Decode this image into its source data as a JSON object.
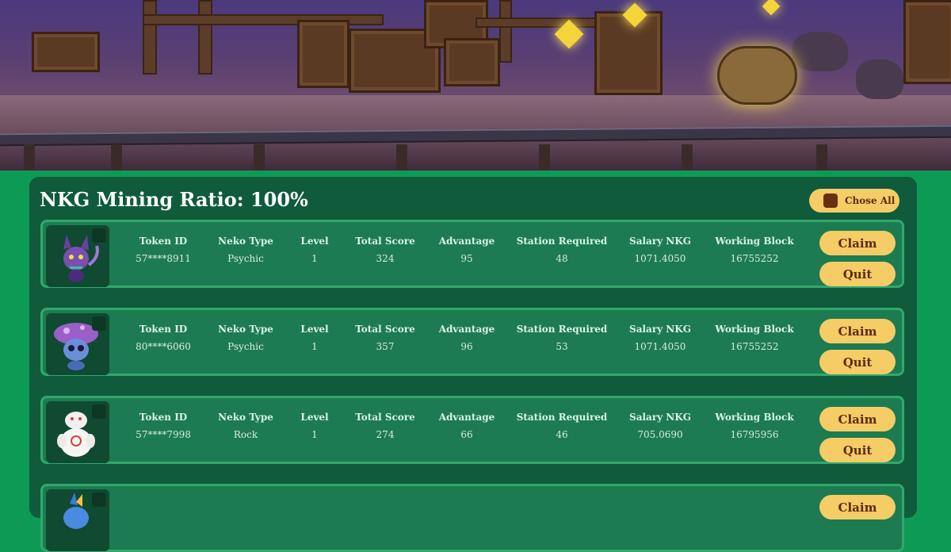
{
  "header": {
    "title": "NKG Mining Ratio: 100%",
    "chose_all_label": "Chose All"
  },
  "columns": [
    "Token ID",
    "Neko Type",
    "Level",
    "Total Score",
    "Advantage",
    "Station Required",
    "Salary NKG",
    "Working Block"
  ],
  "nekos": [
    {
      "values": [
        "57****8911",
        "Psychic",
        "1",
        "324",
        "95",
        "48",
        "1071.4050",
        "16755252"
      ],
      "claim": "Claim",
      "quit": "Quit",
      "avatar": "purple-cat-neko"
    },
    {
      "values": [
        "80****6060",
        "Psychic",
        "1",
        "357",
        "96",
        "53",
        "1071.4050",
        "16755252"
      ],
      "claim": "Claim",
      "quit": "Quit",
      "avatar": "mushroom-neko"
    },
    {
      "values": [
        "57****7998",
        "Rock",
        "1",
        "274",
        "66",
        "46",
        "705.0690",
        "16795956"
      ],
      "claim": "Claim",
      "quit": "Quit",
      "avatar": "white-snowman-neko"
    },
    {
      "values": [
        "",
        "",
        "",
        "",
        "",
        "",
        "",
        ""
      ],
      "claim": "Claim",
      "quit": "",
      "avatar": "blue-neko"
    }
  ],
  "colors": {
    "page_bg": "#0d9a55",
    "panel_bg": "#0f5b3b",
    "row_bg": "#1d7b51",
    "row_border": "#32a86d",
    "button_bg": "#f5cc66",
    "button_text": "#5a2a10"
  }
}
